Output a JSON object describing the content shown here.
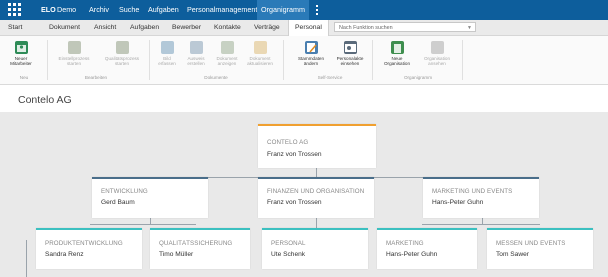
{
  "topbar": {
    "brand": "ELO",
    "items": [
      "Demo",
      "Archiv",
      "Suche",
      "Aufgaben",
      "Personalmanagement",
      "Organigramm"
    ]
  },
  "tabs": [
    "Start",
    "Dokument",
    "Ansicht",
    "Aufgaben",
    "Bewerber",
    "Kontakte",
    "Verträge",
    "Personal"
  ],
  "search": {
    "placeholder": "Nach Funktion suchen"
  },
  "ribbon": {
    "buttons": [
      {
        "label1": "Neuer",
        "label2": "Mitarbeiter",
        "icon": "new-employee-icon",
        "enabled": true
      },
      {
        "label1": "Einstellprozess",
        "label2": "starten",
        "icon": "hiring-process-icon",
        "enabled": false
      },
      {
        "label1": "Qualitätsprozess",
        "label2": "starten",
        "icon": "quality-process-icon",
        "enabled": false
      },
      {
        "label1": "Bild",
        "label2": "erfassen",
        "icon": "capture-image-icon",
        "enabled": false
      },
      {
        "label1": "Ausweis",
        "label2": "erstellen",
        "icon": "id-card-icon",
        "enabled": false
      },
      {
        "label1": "Dokument",
        "label2": "anzeigen",
        "icon": "show-document-icon",
        "enabled": false
      },
      {
        "label1": "Dokument",
        "label2": "aktualisieren",
        "icon": "refresh-document-icon",
        "enabled": false
      },
      {
        "label1": "Stammdaten",
        "label2": "ändern",
        "icon": "edit-master-data-icon",
        "enabled": true
      },
      {
        "label1": "Personalakte",
        "label2": "einsehen",
        "icon": "personnel-file-icon",
        "enabled": true
      },
      {
        "label1": "Neue",
        "label2": "Organisation",
        "icon": "new-organization-icon",
        "enabled": true
      },
      {
        "label1": "Organisation",
        "label2": "ansehen",
        "icon": "view-organization-icon",
        "enabled": false
      }
    ],
    "groups": [
      "Neu",
      "Bearbeiten",
      "Dokumente",
      "Self-Service",
      "Organigramm"
    ]
  },
  "page_title": "Contelo AG",
  "org": {
    "root": {
      "title": "CONTELO AG",
      "name": "Franz von Trossen",
      "color": "#f0a030"
    },
    "level1": [
      {
        "title": "ENTWICKLUNG",
        "name": "Gerd Baum",
        "color": "#4a6e8a"
      },
      {
        "title": "FINANZEN UND ORGANISATION",
        "name": "Franz von Trossen",
        "color": "#4a6e8a"
      },
      {
        "title": "MARKETING UND EVENTS",
        "name": "Hans-Peter Guhn",
        "color": "#4a6e8a"
      }
    ],
    "level2": [
      {
        "title": "PRODUKTENTWICKLUNG",
        "name": "Sandra Renz",
        "color": "#3cc0c0"
      },
      {
        "title": "QUALITÄTSSICHERUNG",
        "name": "Timo Müller",
        "color": "#3cc0c0"
      },
      {
        "title": "PERSONAL",
        "name": "Ute Schenk",
        "color": "#3cc0c0"
      },
      {
        "title": "MARKETING",
        "name": "Hans-Peter Guhn",
        "color": "#3cc0c0"
      },
      {
        "title": "MESSEN UND EVENTS",
        "name": "Tom Sawer",
        "color": "#3cc0c0"
      }
    ]
  }
}
